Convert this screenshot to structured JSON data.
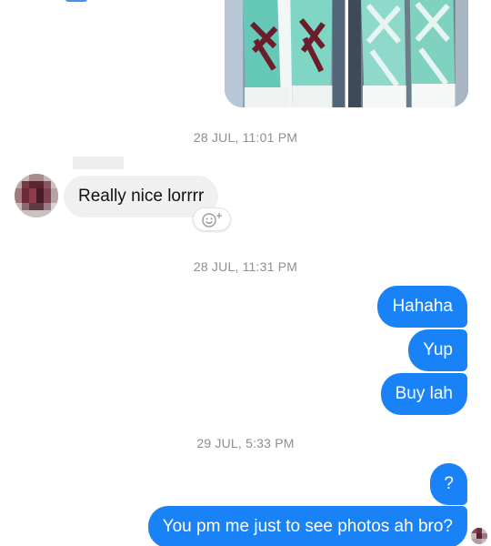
{
  "thread": {
    "photos": [
      {
        "icon": "sneaker-photo",
        "shoe_color": "#66c9b8",
        "stripe_color": "#6b1d2a",
        "bg": "#8ba0b8"
      },
      {
        "icon": "sneaker-photo",
        "shoe_color": "#7fd2c0",
        "stripe_color": "#e8f4f2",
        "bg": "#6d7c8c"
      }
    ],
    "timestamps": [
      "28 JUL, 11:01 PM",
      "28 JUL, 11:31 PM",
      "29 JUL, 5:33 PM"
    ],
    "incoming": {
      "avatar_icon": "pixelated-avatar",
      "text": "Really nice lorrrr",
      "reaction_icon": "add-reaction-icon"
    },
    "outgoing_group_1": [
      "Hahaha",
      "Yup",
      "Buy lah"
    ],
    "outgoing_group_2": [
      "?",
      "You pm me just to see photos ah bro?"
    ],
    "read_receipt_icon": "seen-avatar"
  },
  "colors": {
    "outgoing_bubble": "#1a82f7",
    "incoming_bubble": "#f0f0f0",
    "timestamp": "#8e8e93"
  }
}
